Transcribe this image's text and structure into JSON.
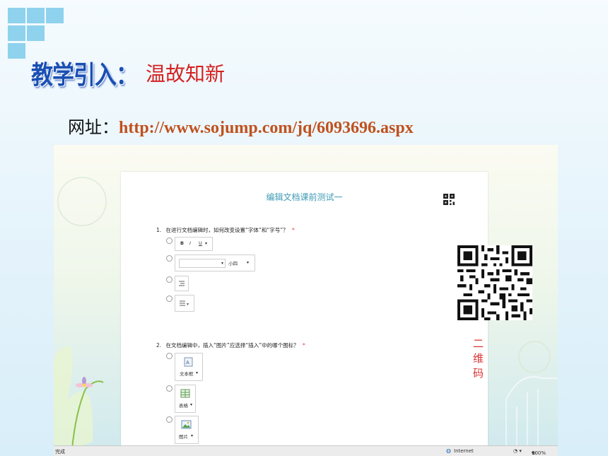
{
  "slide": {
    "title": "教学引入：",
    "subtitle": "温故知新",
    "url_label": "网址：",
    "url": "http://www.sojump.com/jq/6093696.aspx"
  },
  "survey": {
    "title": "编辑文档课前测试一",
    "q1": {
      "number": "1.",
      "text": "在进行文档编辑时，如何改变设置“字体”和“字号”？",
      "required_mark": "*",
      "opt1_buttons": [
        "B",
        "I",
        "U"
      ],
      "opt2_size": "小四"
    },
    "q2": {
      "number": "2.",
      "text": "在文档编辑中，插入“图片”应选择“插入”中的哪个图标？",
      "required_mark": "*",
      "opt1_label": "文本框",
      "opt2_label": "表格",
      "opt3_label": "图片"
    },
    "qr_caption": "二维码"
  },
  "statusbar": {
    "left": "完成",
    "zone": "Internet",
    "zoom": "100%"
  },
  "colors": {
    "title_blue": "#1a4fb3",
    "subtitle_red": "#d52020",
    "url_orange": "#c0511e",
    "survey_title_teal": "#3f9bb5"
  }
}
